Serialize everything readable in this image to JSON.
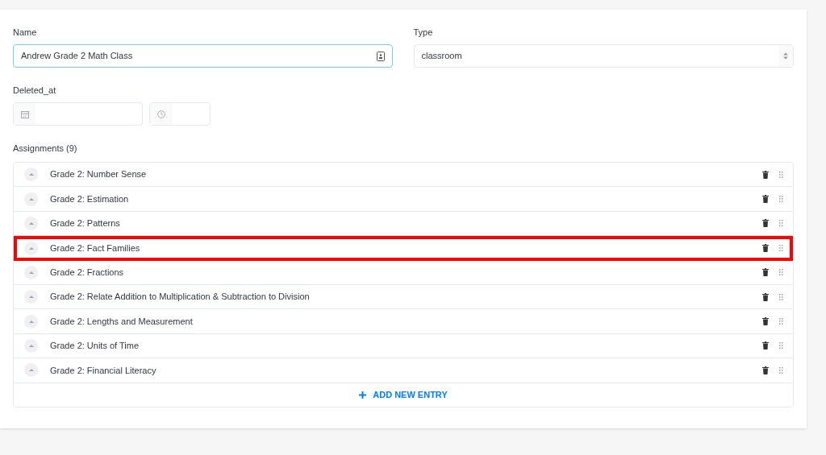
{
  "name_field": {
    "label": "Name",
    "value": "Andrew Grade 2 Math Class",
    "focused": true
  },
  "type_field": {
    "label": "Type",
    "value": "classroom"
  },
  "deleted_at": {
    "label": "Deleted_at"
  },
  "assignments": {
    "label": "Assignments (9)",
    "add_label": "ADD NEW ENTRY",
    "items": [
      {
        "title": "Grade 2: Number Sense",
        "highlighted": false
      },
      {
        "title": "Grade 2: Estimation",
        "highlighted": false
      },
      {
        "title": "Grade 2: Patterns",
        "highlighted": false
      },
      {
        "title": "Grade 2: Fact Families",
        "highlighted": true
      },
      {
        "title": "Grade 2: Fractions",
        "highlighted": false
      },
      {
        "title": "Grade 2: Relate Addition to Multiplication & Subtraction to Division",
        "highlighted": false
      },
      {
        "title": "Grade 2: Lengths and Measurement",
        "highlighted": false
      },
      {
        "title": "Grade 2: Units of Time",
        "highlighted": false
      },
      {
        "title": "Grade 2: Financial Literacy",
        "highlighted": false
      }
    ]
  }
}
